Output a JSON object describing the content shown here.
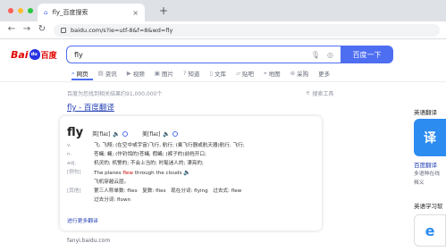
{
  "browser": {
    "tab_title": "fly_百度搜索",
    "url": "baidu.com/s?ie=utf-8&f=8&wd=fly",
    "dot_colors": [
      "#ff5f57",
      "#febc2e",
      "#28c840"
    ]
  },
  "header": {
    "logo_bai": "Bai",
    "logo_paw": "du",
    "logo_du": "百度",
    "search_value": "fly",
    "search_button": "百度一下"
  },
  "tabs": [
    {
      "label": "网页",
      "icon": "search-icon"
    },
    {
      "label": "资讯",
      "icon": "news-icon"
    },
    {
      "label": "视频",
      "icon": "video-icon"
    },
    {
      "label": "图片",
      "icon": "image-icon"
    },
    {
      "label": "知道",
      "icon": "question-icon"
    },
    {
      "label": "文库",
      "icon": "doc-icon"
    },
    {
      "label": "贴吧",
      "icon": "forum-icon"
    },
    {
      "label": "地图",
      "icon": "map-icon"
    },
    {
      "label": "采购",
      "icon": "shop-icon"
    },
    {
      "label": "更多",
      "icon": ""
    }
  ],
  "results": {
    "count_text": "百度为您找到相关结果约91,000,000个",
    "tools_label": "搜索工具",
    "title": "fly - 百度翻译",
    "source": "fanyi.baidu.com"
  },
  "card": {
    "word": "fly",
    "uk_label": "英[flaɪ]",
    "us_label": "美[flaɪ]",
    "defs": [
      {
        "pos": "v.",
        "text": "飞; 飞翔; (在空中或宇宙)飞行, 航行; (乘飞行器或航天器)航行, 飞行;"
      },
      {
        "pos": "n.",
        "text": "苍蝇; 蝇; (作钓饵的)苍蝇, 假蝇; (裤子的)前裆开口;"
      },
      {
        "pos": "adj.",
        "text": "机灵的; 机警的; 不会上当的; 时髦迷人的; 漂亮的;"
      }
    ],
    "example_tag": "[例句]",
    "example_pre": "The planes ",
    "example_hl": "flew",
    "example_post": " through the clouds",
    "example_cn": "飞机穿越云层。",
    "forms_tag": "[其他]",
    "forms_line1": "第三人称单数: flies　复数: flies　现在分词: flying　过去式: flew",
    "forms_line2": "过去分词: flown",
    "more_link": "进行更多翻译"
  },
  "right": {
    "title1": "英语翻译",
    "app_icon_char": "译",
    "app_name": "百度翻译",
    "app_desc1": "多语种在线",
    "app_desc2": "释义",
    "title2": "英语学习软"
  }
}
